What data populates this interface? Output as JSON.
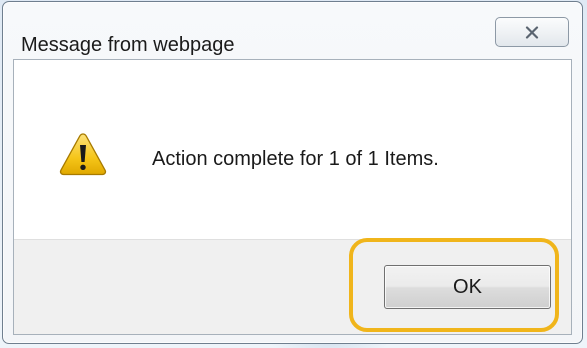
{
  "window": {
    "title": "Message from webpage"
  },
  "dialog": {
    "icon": "warning-icon",
    "message": "Action complete for 1 of 1 Items.",
    "ok_label": "OK"
  },
  "colors": {
    "highlight": "#f0b51b",
    "warning_fill": "#f5c518",
    "button_area": "#f0f0f0"
  }
}
